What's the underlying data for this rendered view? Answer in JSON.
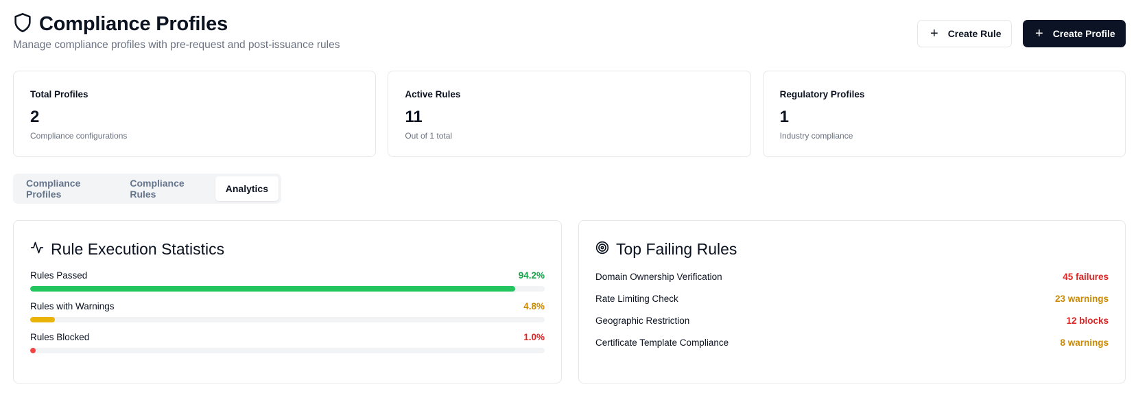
{
  "header": {
    "title": "Compliance Profiles",
    "subtitle": "Manage compliance profiles with pre-request and post-issuance rules"
  },
  "actions": {
    "create_rule": "Create Rule",
    "create_profile": "Create Profile"
  },
  "stats": [
    {
      "label": "Total Profiles",
      "value": "2",
      "caption": "Compliance configurations"
    },
    {
      "label": "Active Rules",
      "value": "11",
      "caption": "Out of 1 total"
    },
    {
      "label": "Regulatory Profiles",
      "value": "1",
      "caption": "Industry compliance"
    }
  ],
  "tabs": [
    {
      "label": "Compliance Profiles",
      "active": false
    },
    {
      "label": "Compliance Rules",
      "active": false
    },
    {
      "label": "Analytics",
      "active": true
    }
  ],
  "execution": {
    "title": "Rule Execution Statistics",
    "metrics": [
      {
        "label": "Rules Passed",
        "pct_text": "94.2%",
        "value": 94.2,
        "color": "#16a34a",
        "bar_color": "#22c55e"
      },
      {
        "label": "Rules with Warnings",
        "pct_text": "4.8%",
        "value": 4.8,
        "color": "#ca8a04",
        "bar_color": "#eab308"
      },
      {
        "label": "Rules Blocked",
        "pct_text": "1.0%",
        "value": 1.0,
        "color": "#dc2626",
        "bar_color": "#ef4444"
      }
    ]
  },
  "failing": {
    "title": "Top Failing Rules",
    "rules": [
      {
        "name": "Domain Ownership Verification",
        "result": "45 failures",
        "color": "#dc2626"
      },
      {
        "name": "Rate Limiting Check",
        "result": "23 warnings",
        "color": "#ca8a04"
      },
      {
        "name": "Geographic Restriction",
        "result": "12 blocks",
        "color": "#dc2626"
      },
      {
        "name": "Certificate Template Compliance",
        "result": "8 warnings",
        "color": "#ca8a04"
      }
    ]
  },
  "icons": {
    "title": "shield-icon",
    "create": "plus-icon",
    "execution": "activity-icon",
    "failing": "target-icon"
  }
}
